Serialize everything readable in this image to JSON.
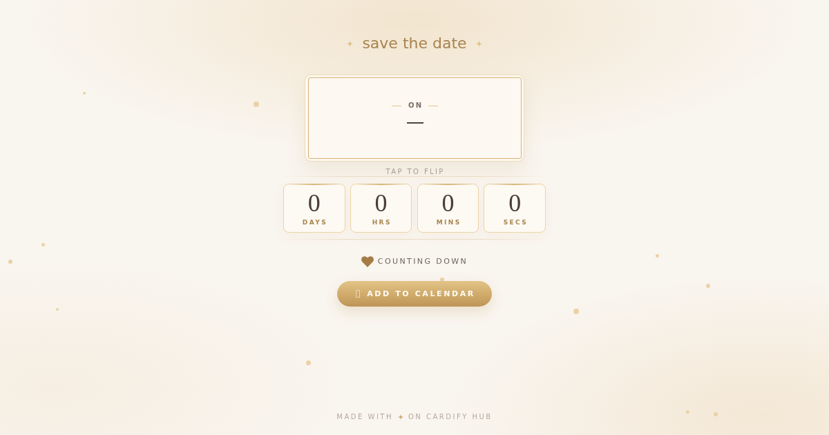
{
  "title": "save the date",
  "card": {
    "label": "ON",
    "hint": "TAP TO FLIP"
  },
  "countdown": [
    {
      "value": "0",
      "unit": "DAYS"
    },
    {
      "value": "0",
      "unit": "HRS"
    },
    {
      "value": "0",
      "unit": "MINS"
    },
    {
      "value": "0",
      "unit": "SECS"
    }
  ],
  "status": {
    "text": "COUNTING DOWN"
  },
  "button": {
    "label": "ADD TO CALENDAR"
  },
  "footer": {
    "before": "MADE WITH",
    "after": "ON CARDIFY HUB"
  }
}
